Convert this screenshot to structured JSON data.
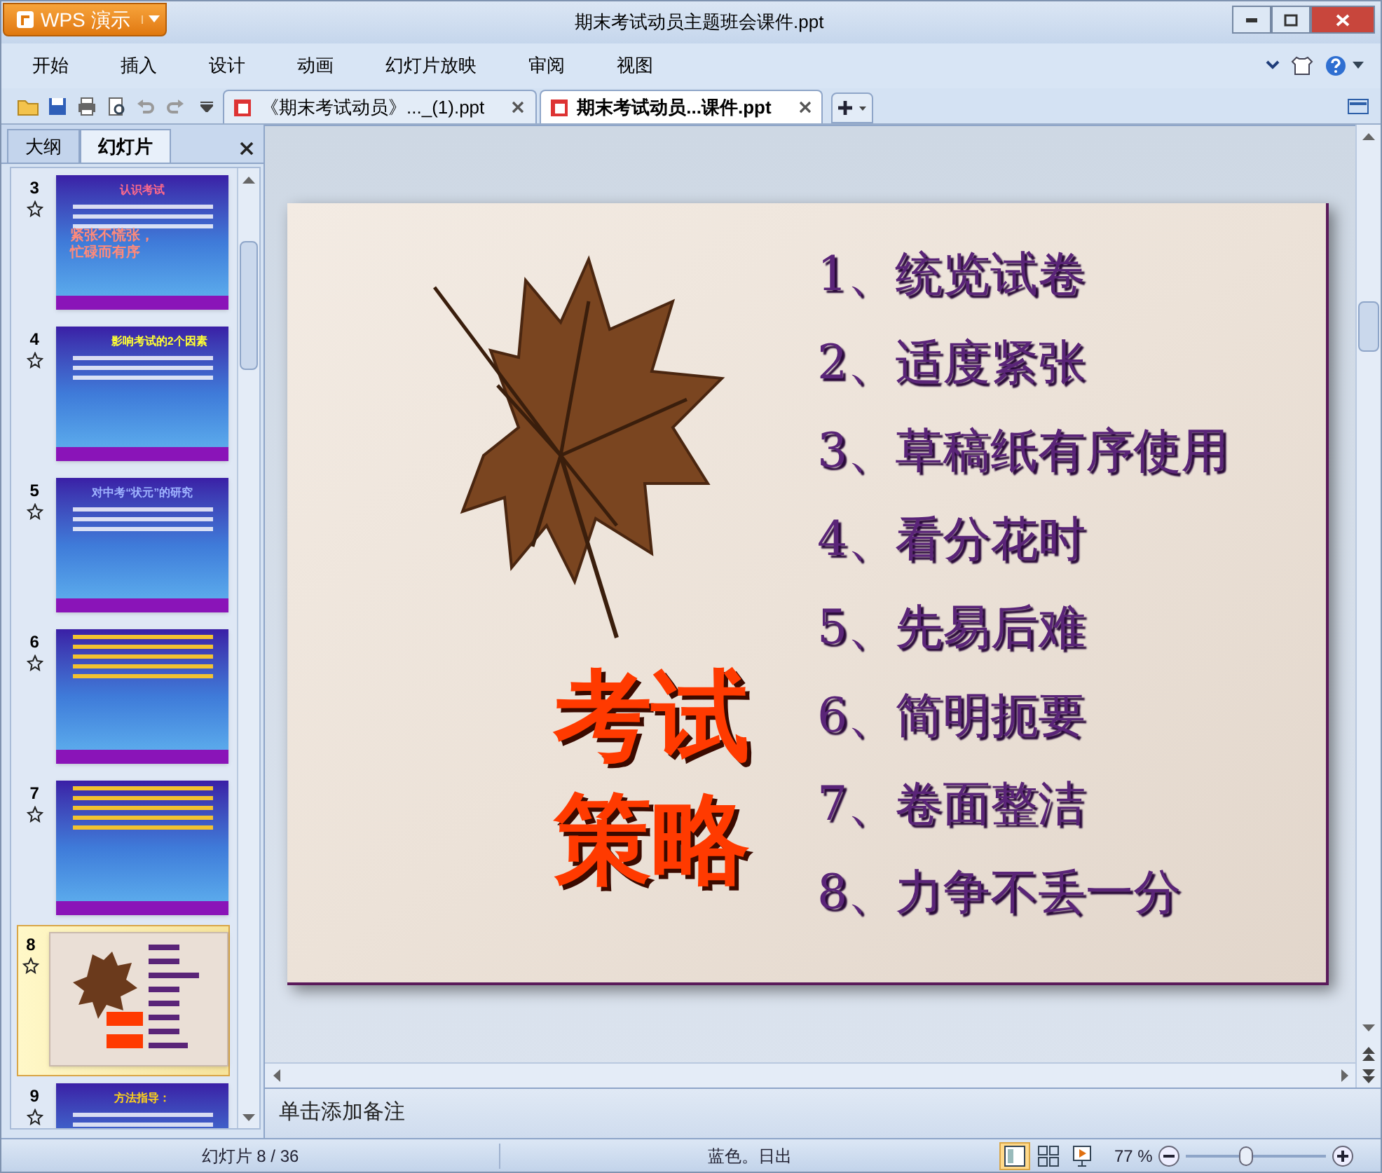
{
  "window": {
    "app_button": "WPS 演示",
    "title": "期末考试动员主题班会课件.ppt"
  },
  "menu": [
    {
      "label": "开始"
    },
    {
      "label": "插入"
    },
    {
      "label": "设计"
    },
    {
      "label": "动画"
    },
    {
      "label": "幻灯片放映"
    },
    {
      "label": "审阅"
    },
    {
      "label": "视图"
    }
  ],
  "document_tabs": [
    {
      "label": "《期末考试动员》..._(1).ppt",
      "selected": false
    },
    {
      "label": "期末考试动员...课件.ppt",
      "selected": true
    }
  ],
  "pane_tabs": [
    {
      "label": "大纲",
      "selected": false
    },
    {
      "label": "幻灯片",
      "selected": true
    }
  ],
  "thumbnails": [
    {
      "number": "3",
      "kind": "blue",
      "selected": false,
      "title": "认识考试",
      "lines": [
        "紧张不慌张，",
        "忙碌而有序"
      ]
    },
    {
      "number": "4",
      "kind": "blue",
      "selected": false,
      "title": "影响考试的2个因素"
    },
    {
      "number": "5",
      "kind": "blue",
      "selected": false,
      "title": "对中考“状元”的研究"
    },
    {
      "number": "6",
      "kind": "blue",
      "selected": false
    },
    {
      "number": "7",
      "kind": "blue",
      "selected": false
    },
    {
      "number": "8",
      "kind": "photo",
      "selected": true
    },
    {
      "number": "9",
      "kind": "blue",
      "selected": false,
      "title": "方法指导："
    }
  ],
  "slide": {
    "heading_lines": [
      "考试",
      "策略"
    ],
    "items": [
      "1、统览试卷",
      "2、适度紧张",
      "3、草稿纸有序使用",
      "4、看分花时",
      "5、先易后难",
      "6、简明扼要",
      "7、卷面整洁",
      "8、力争不丢一分"
    ]
  },
  "notes": {
    "placeholder": "单击添加备注"
  },
  "status_bar": {
    "slide_counter": "幻灯片 8 / 36",
    "theme": "蓝色。日出",
    "zoom": "77 %",
    "zoom_slider": {
      "level": 0.42
    }
  }
}
